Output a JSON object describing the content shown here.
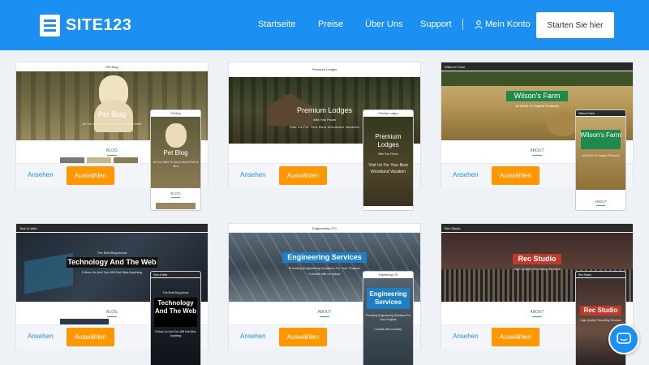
{
  "brand": {
    "name": "SITE123",
    "accent": "#1b8ff2",
    "button_color": "#ff9800"
  },
  "nav": {
    "links": [
      "Startseite",
      "Preise",
      "Über Uns",
      "Support"
    ],
    "account": "Mein Konto",
    "cta": "Starten Sie hier"
  },
  "templates": [
    {
      "site_name": "Pet Blog",
      "hero_title": "Pet Blog",
      "hero_sub": "All You Want To Know About Pets Is Here",
      "section": "BLOG",
      "view_label": "Ansehen",
      "select_label": "Auswählen"
    },
    {
      "site_name": "Premium Lodges",
      "hero_title": "Premium Lodges",
      "hero_sub": "With Fair Prices",
      "hero_sub2": "Visit Us For Your Best Woodland Vacation",
      "view_label": "Ansehen",
      "select_label": "Auswählen"
    },
    {
      "site_name": "Wilson's Farm",
      "hero_title": "Wilson's Farm",
      "hero_sub": "All Kinds Of Organic Products",
      "section": "ABOUT",
      "view_label": "Ansehen",
      "select_label": "Auswählen"
    },
    {
      "site_name": "Tech & Web",
      "hero_title": "Technology And The Web",
      "hero_pre": "The Best Blog About",
      "hero_sub": "Follow Us And You Will Not Miss Anything",
      "section": "BLOG",
      "view_label": "Ansehen",
      "select_label": "Auswählen"
    },
    {
      "site_name": "Engineering LTD",
      "hero_title": "Engineering Services",
      "hero_sub": "Providing Engineering Solutions For Your Projects",
      "hero_sub2": "Consult with us today!",
      "section": "ABOUT",
      "view_label": "Ansehen",
      "select_label": "Auswählen"
    },
    {
      "site_name": "Rec Studio",
      "hero_title": "Rec Studio",
      "hero_sub": "High Quality Recording Services",
      "section": "ABOUT",
      "view_label": "Ansehen",
      "select_label": "Auswählen"
    }
  ]
}
